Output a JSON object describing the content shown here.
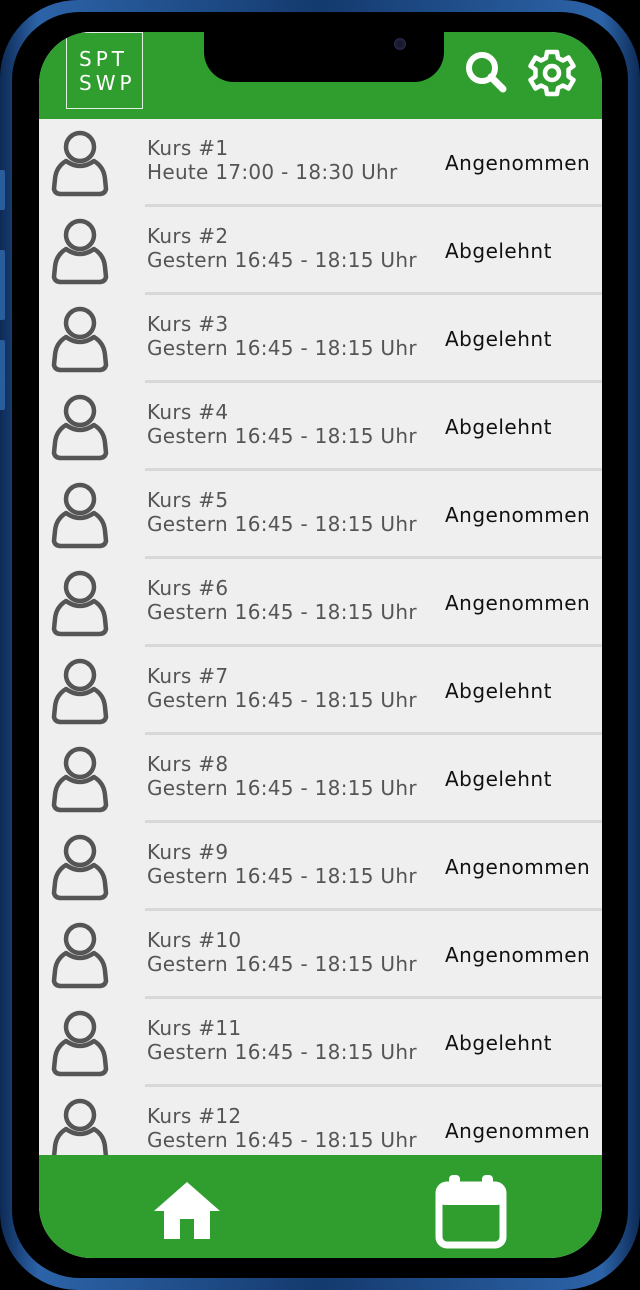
{
  "app": {
    "logo_line1": "SPT",
    "logo_line2": "SWP"
  },
  "header": {
    "search_icon": "search-icon",
    "settings_icon": "gear-icon",
    "accent_color": "#2f9e2f"
  },
  "courses": [
    {
      "title": "Kurs #1",
      "time": "Heute 17:00 - 18:30 Uhr",
      "status": "Angenommen"
    },
    {
      "title": "Kurs #2",
      "time": "Gestern 16:45 - 18:15 Uhr",
      "status": "Abgelehnt"
    },
    {
      "title": "Kurs #3",
      "time": "Gestern 16:45 - 18:15 Uhr",
      "status": "Abgelehnt"
    },
    {
      "title": "Kurs #4",
      "time": "Gestern 16:45 - 18:15 Uhr",
      "status": "Abgelehnt"
    },
    {
      "title": "Kurs #5",
      "time": "Gestern 16:45 - 18:15 Uhr",
      "status": "Angenommen"
    },
    {
      "title": "Kurs #6",
      "time": "Gestern 16:45 - 18:15 Uhr",
      "status": "Angenommen"
    },
    {
      "title": "Kurs #7",
      "time": "Gestern 16:45 - 18:15 Uhr",
      "status": "Abgelehnt"
    },
    {
      "title": "Kurs #8",
      "time": "Gestern 16:45 - 18:15 Uhr",
      "status": "Abgelehnt"
    },
    {
      "title": "Kurs #9",
      "time": "Gestern 16:45 - 18:15 Uhr",
      "status": "Angenommen"
    },
    {
      "title": "Kurs #10",
      "time": "Gestern 16:45 - 18:15 Uhr",
      "status": "Angenommen"
    },
    {
      "title": "Kurs #11",
      "time": "Gestern 16:45 - 18:15 Uhr",
      "status": "Abgelehnt"
    },
    {
      "title": "Kurs #12",
      "time": "Gestern 16:45 - 18:15 Uhr",
      "status": "Angenommen"
    }
  ],
  "footer": {
    "home_icon": "home-icon",
    "calendar_icon": "calendar-icon"
  }
}
